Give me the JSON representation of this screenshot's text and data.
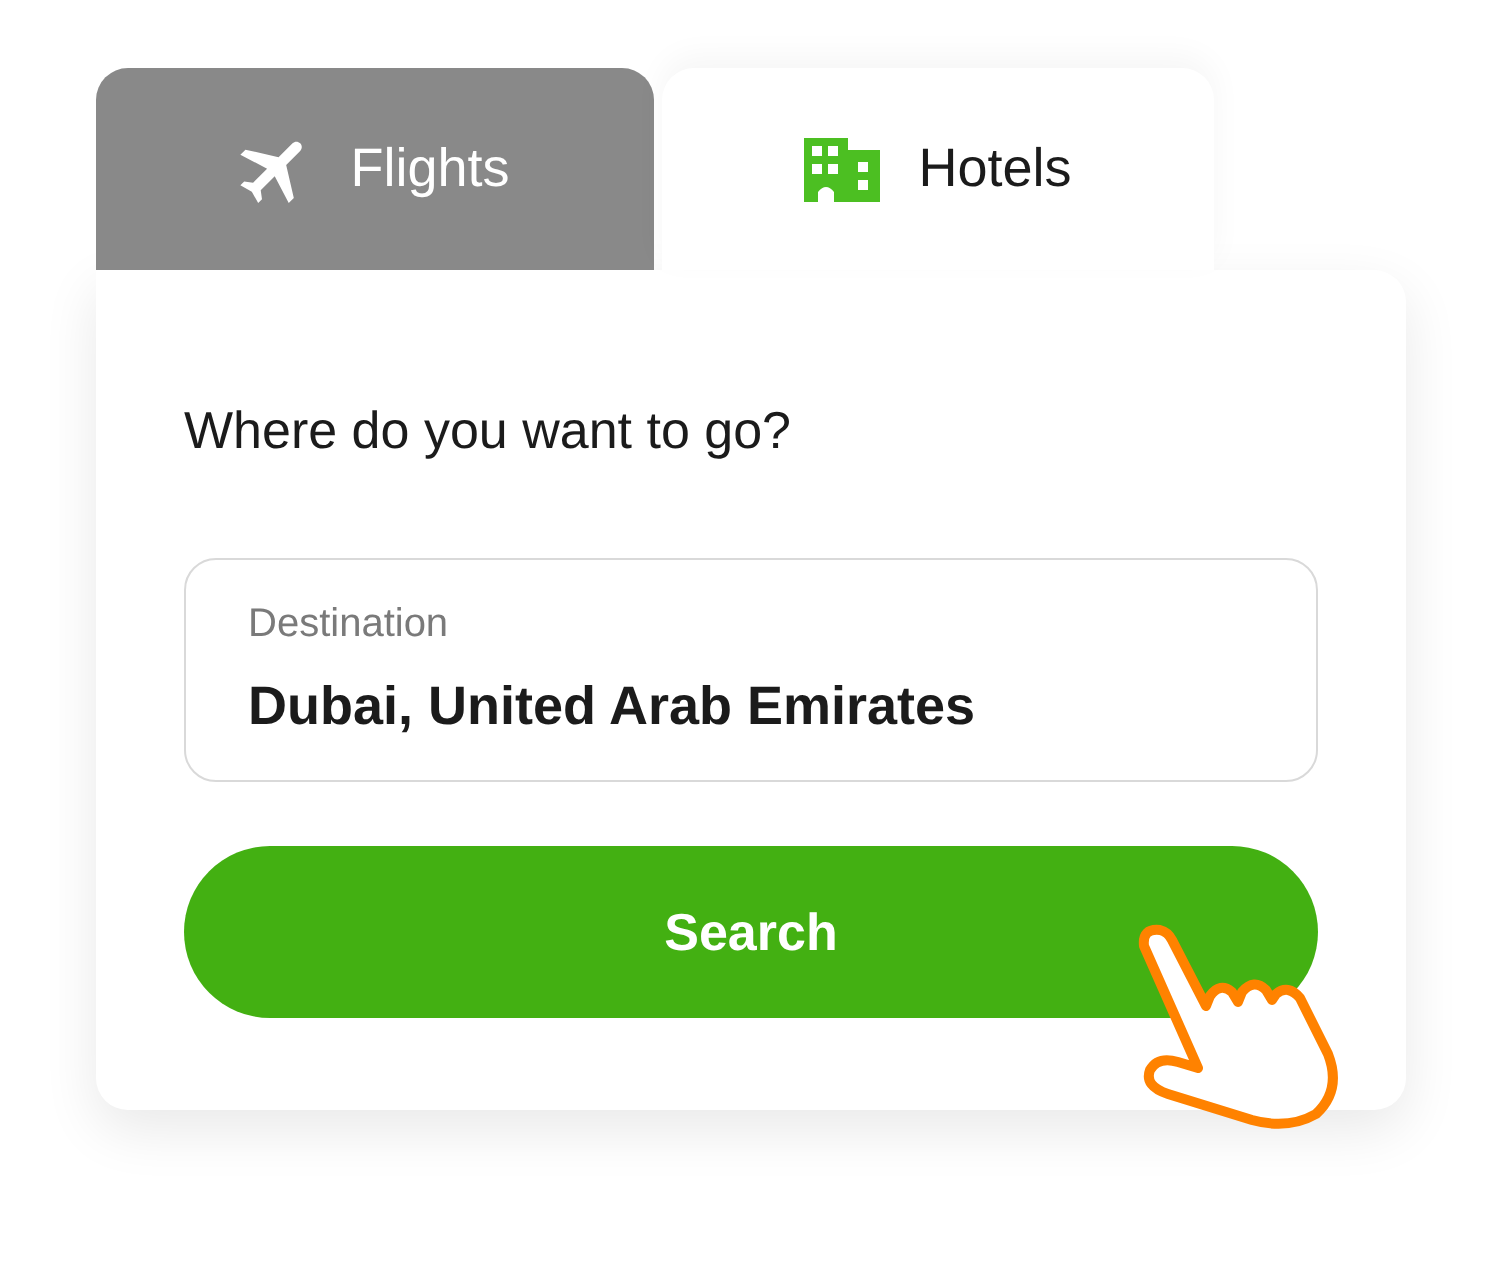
{
  "tabs": [
    {
      "label": "Flights",
      "selected": false,
      "kind": "flight"
    },
    {
      "label": "Hotels",
      "selected": true,
      "kind": "hotel"
    }
  ],
  "search_form": {
    "heading": "Where do you want to go?",
    "destination": {
      "label": "Destination",
      "value": "Dubai, United Arab Emirates"
    },
    "button": "Search"
  }
}
